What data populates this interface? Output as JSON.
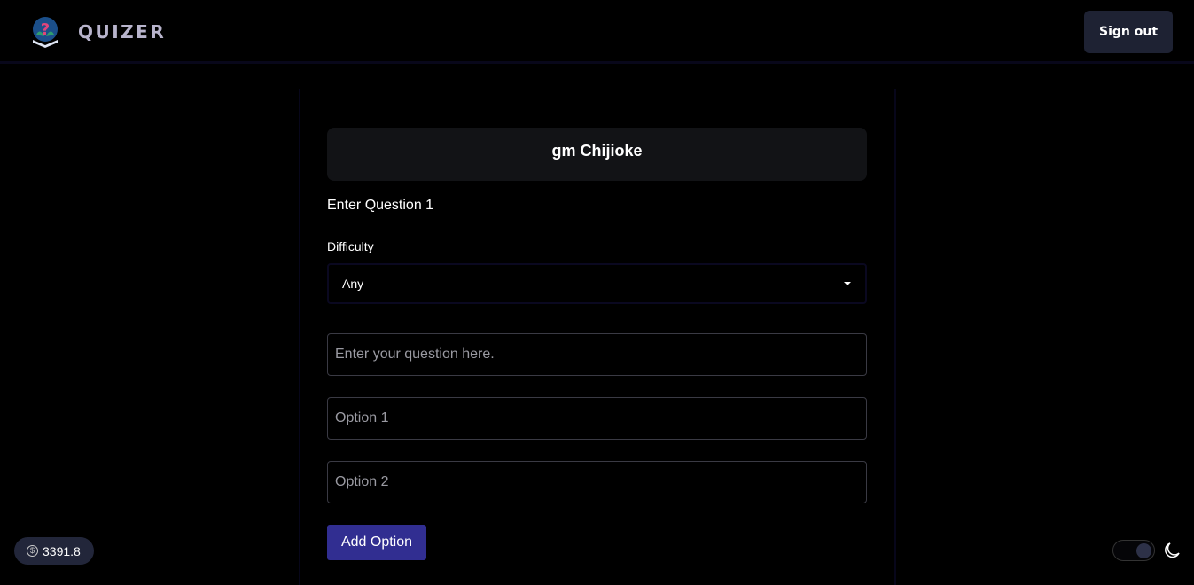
{
  "header": {
    "brand": "QUIZER",
    "sign_out": "Sign out"
  },
  "greeting": "gm Chijioke",
  "form": {
    "question_heading": "Enter Question 1",
    "difficulty_label": "Difficulty",
    "difficulty_value": "Any",
    "question_placeholder": "Enter your question here.",
    "option1_placeholder": "Option 1",
    "option2_placeholder": "Option 2",
    "add_option": "Add Option"
  },
  "footer": {
    "balance": "3391.8",
    "theme": "dark"
  },
  "colors": {
    "accent": "#312e91",
    "button_bg": "#1e2233"
  }
}
